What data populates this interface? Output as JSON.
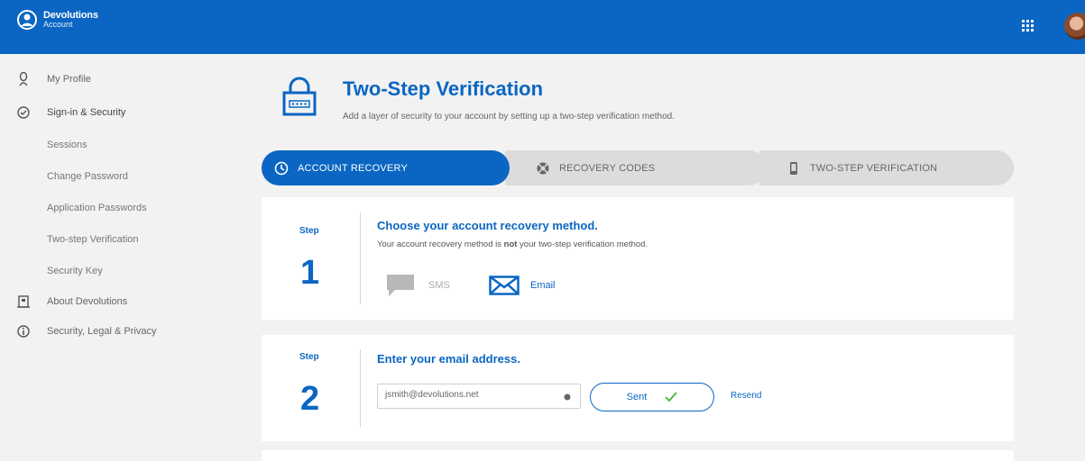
{
  "header": {
    "brand_name": "Devolutions",
    "brand_sub": "Account"
  },
  "sidebar": {
    "items": [
      {
        "label": "My Profile",
        "icon": "user-icon"
      },
      {
        "label": "Sign-in & Security",
        "icon": "shield-icon"
      },
      {
        "label": "Sessions"
      },
      {
        "label": "Change Password"
      },
      {
        "label": "Application Passwords"
      },
      {
        "label": "Two-step Verification"
      },
      {
        "label": "Security Key"
      },
      {
        "label": "About Devolutions",
        "icon": "building-icon"
      },
      {
        "label": "Security, Legal & Privacy",
        "icon": "info-icon"
      }
    ]
  },
  "page": {
    "title": "Two-Step Verification",
    "subtitle": "Add a layer of security to your account by setting up a two-step verification method."
  },
  "tabs": [
    {
      "label": "ACCOUNT RECOVERY",
      "active": true
    },
    {
      "label": "RECOVERY CODES",
      "active": false
    },
    {
      "label": "TWO-STEP VERIFICATION",
      "active": false
    }
  ],
  "step1": {
    "label": "Step",
    "number": "1",
    "title": "Choose your account recovery method.",
    "desc_before": "Your account recovery method is ",
    "desc_bold": "not",
    "desc_after": " your two-step verification method.",
    "sms_label": "SMS",
    "email_label": "Email"
  },
  "step2": {
    "label": "Step",
    "number": "2",
    "title": "Enter your email address.",
    "email_value": "jsmith@devolutions.net",
    "send_label": "Sent",
    "resend_label": "Resend"
  },
  "colors": {
    "primary": "#0a66c2",
    "background": "#f2f2f2",
    "tab_inactive": "#dcdcdc"
  }
}
